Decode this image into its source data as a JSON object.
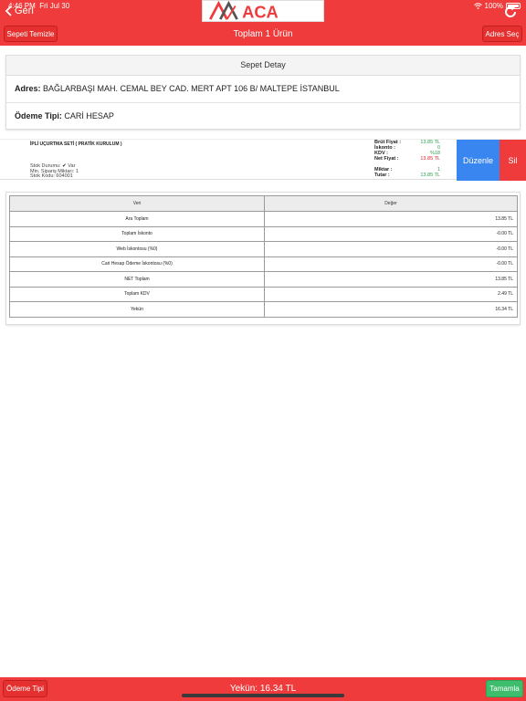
{
  "status": {
    "time": "4:46 PM",
    "date": "Fri Jul 30",
    "battery": "100%"
  },
  "nav": {
    "back_label": "Geri",
    "logo_text": "ACA"
  },
  "toolbar": {
    "clear_label": "Sepeti Temizle",
    "title": "Toplam 1 Ürün",
    "address_label": "Adres Seç"
  },
  "detail": {
    "header": "Sepet Detay",
    "address_key": "Adres:",
    "address_value": "BAĞLARBAŞI MAH. CEMAL BEY CAD. MERT APT 106 B/ MALTEPE İSTANBUL",
    "payment_key": "Ödeme Tipi:",
    "payment_value": "CARİ HESAP"
  },
  "product": {
    "name": "İPLİ UÇURTMA SETİ ( PRATİK KURULUM )",
    "stock_status_key": "Stok Durumu:",
    "stock_status_value": "Var",
    "min_order": "Min. Sipariş Miktarı: 1",
    "stock_code": "Stok Kodu: 604001",
    "prices": [
      {
        "key": "Brüt Fiyat :",
        "value": "13.85 TL",
        "color": "#2ca24a"
      },
      {
        "key": "İskonto :",
        "value": "0",
        "color": "#2ca24a"
      },
      {
        "key": "KDV :",
        "value": "%18",
        "color": "#2ca24a"
      },
      {
        "key": "Net Fiyat :",
        "value": "13.85 TL",
        "color": "#e0262b"
      }
    ],
    "totals": [
      {
        "key": "Miktar :",
        "value": "1",
        "color": "#2ca24a"
      },
      {
        "key": "Tutar :",
        "value": "13.85 TL",
        "color": "#2ca24a"
      }
    ],
    "edit_label": "Düzenle",
    "delete_label": "Sil"
  },
  "summary": {
    "headers": [
      "Veri",
      "Değer"
    ],
    "rows": [
      {
        "label": "Ara Toplam",
        "value": "13.85 TL"
      },
      {
        "label": "Toplam İskonto",
        "value": "-0.00 TL"
      },
      {
        "label": "Web İskontosu (%0)",
        "value": "-0.00 TL"
      },
      {
        "label": "Cari Hesap Ödeme İskontosu (%0)",
        "value": "-0.00 TL"
      },
      {
        "label": "NET Toplam",
        "value": "13.85 TL"
      },
      {
        "label": "Toplam KDV",
        "value": "2.49 TL"
      },
      {
        "label": "Yekün",
        "value": "16.34 TL"
      }
    ]
  },
  "bottom": {
    "payment_type_label": "Ödeme Tipi",
    "total_text": "Yekün: 16.34 TL",
    "done_label": "Tamamla"
  },
  "colors": {
    "brand_red": "#ef3b3b",
    "edit_blue": "#3a86f0",
    "done_green": "#3ebd6c"
  }
}
